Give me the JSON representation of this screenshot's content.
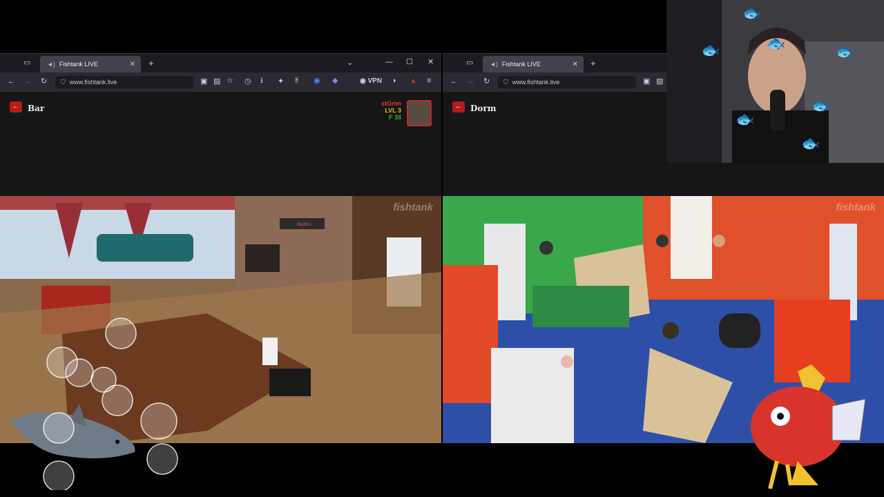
{
  "left": {
    "tab_title": "Fishtank LIVE",
    "url": "www.fishtank.live",
    "vpn_label": "VPN",
    "room_name": "Bar",
    "watermark": "fishtank",
    "sign_text": "~BASH~",
    "user": {
      "name": "stGrim",
      "level": "LVL 3",
      "coins": "F 38"
    }
  },
  "right": {
    "tab_title": "Fishtank LIVE",
    "url": "www.fishtank.live",
    "room_name": "Dorm",
    "watermark": "fishtank"
  }
}
